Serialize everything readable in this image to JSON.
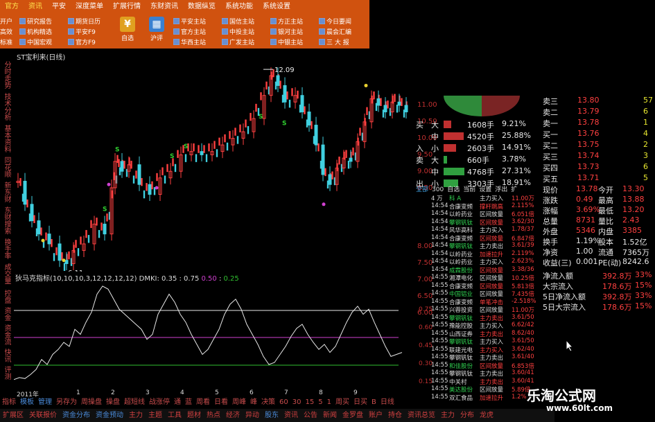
{
  "menu": {
    "tabs": [
      "官方",
      "资讯",
      "平安",
      "深度菜单",
      "扩展行情",
      "东财资讯",
      "数据纵览",
      "系统功能",
      "系统设置"
    ],
    "shortcuts": [
      [
        "开户",
        "研究报告",
        "期货日历"
      ],
      [
        "高效",
        "机构精选",
        "平安F9"
      ],
      [
        "标准",
        "中国宏观",
        "官方F9"
      ]
    ],
    "big": [
      "自选",
      "沪评"
    ],
    "sites": [
      [
        "平安主站",
        "国信主站",
        "方正主站",
        "今日要闻"
      ],
      [
        "官方主站",
        "中投主站",
        "银河主站",
        "晨会汇编"
      ],
      [
        "华西主站",
        "广发主站",
        "中银主站",
        "三 大 报"
      ]
    ]
  },
  "chart": {
    "title": "ST宝利来(日线)",
    "high_label": "12.09",
    "low_label": "6.11",
    "indicator_label": "狄马克指标(10,10,10,3,12,12,12,12) DMKI: 0.35 : 0.75",
    "ind_v1": "0.50",
    "ind_v2": "0.25",
    "x_ticks": [
      "2011年",
      "1",
      "2",
      "3",
      "4",
      "5",
      "6",
      "7",
      "8",
      "9"
    ],
    "k_scale": [
      "11.00",
      "10.50",
      "10.00",
      "9.50",
      "9.00",
      "8.50",
      "8.00",
      "7.50",
      "7.00",
      "6.50",
      "6.00"
    ],
    "i_scale": [
      "0.75",
      "0.60",
      "0.45",
      "0.30",
      "0.15"
    ],
    "colors": {
      "up": "#ff4040",
      "down": "#40d0e0",
      "ma": "#e8e8e8"
    }
  },
  "vtabs": [
    "分时走势",
    "技术分析",
    "基本资料",
    "同花顺",
    "新东财",
    "东财搜索",
    "换手率",
    "成交量"
  ],
  "vtabs2": [
    "控盘",
    "资金",
    "资金流",
    "快讯",
    "评测"
  ],
  "ask": [
    {
      "l": "卖三",
      "p": "13.80",
      "v": "57"
    },
    {
      "l": "卖二",
      "p": "13.79",
      "v": "6"
    },
    {
      "l": "卖一",
      "p": "13.78",
      "v": "1"
    },
    {
      "l": "买一",
      "p": "13.76",
      "v": "4"
    },
    {
      "l": "买二",
      "p": "13.75",
      "v": "2"
    },
    {
      "l": "买三",
      "p": "13.74",
      "v": "3"
    },
    {
      "l": "买四",
      "p": "13.73",
      "v": "6"
    },
    {
      "l": "买五",
      "p": "13.71",
      "v": "5"
    }
  ],
  "flow": [
    {
      "a": "买",
      "b": "大",
      "v": "1608手",
      "p": "9.21%"
    },
    {
      "a": "",
      "b": "中",
      "v": "4520手",
      "p": "25.88%"
    },
    {
      "a": "入",
      "b": "小",
      "v": "2603手",
      "p": "14.91%"
    },
    {
      "a": "卖",
      "b": "大",
      "v": "660手",
      "p": "3.78%"
    },
    {
      "a": "",
      "b": "中",
      "v": "4768手",
      "p": "27.31%"
    },
    {
      "a": "出",
      "b": "小",
      "v": "3303手",
      "p": "18.91%"
    }
  ],
  "flow_fracs": [
    0.35,
    0.9,
    0.55,
    0.15,
    0.95,
    0.65
  ],
  "qtabs": [
    "全部",
    "300",
    "自选",
    "当前",
    "设置",
    "浮出",
    "扩"
  ],
  "stats": [
    {
      "k": "现价",
      "v": "13.78",
      "k2": "今开",
      "v2": "13.30"
    },
    {
      "k": "涨跌",
      "v": "0.49",
      "k2": "最高",
      "v2": "13.88"
    },
    {
      "k": "涨幅",
      "v": "3.69%",
      "k2": "最低",
      "v2": "13.20"
    },
    {
      "k": "总量",
      "v": "8731",
      "k2": "量比",
      "v2": "2.43"
    },
    {
      "k": "外盘",
      "v": "5346",
      "k2": "内盘",
      "v2": "3385"
    },
    {
      "k": "换手",
      "v": "1.19%",
      "k2": "股本",
      "v2": "1.52亿"
    },
    {
      "k": "净资",
      "v": "1.00",
      "k2": "流通",
      "v2": "7365万"
    },
    {
      "k": "收益(三)",
      "v": "0.001",
      "k2": "PE(动)",
      "v2": "8242.6"
    }
  ],
  "netflow": [
    {
      "k": "净流入额",
      "v": "392.8万",
      "p": "33%"
    },
    {
      "k": "大宗流入",
      "v": "178.6万",
      "p": "15%"
    },
    {
      "k": "5日净流入额",
      "v": "392.8万",
      "p": "33%"
    },
    {
      "k": "5日大宗流入",
      "v": "178.6万",
      "p": "15%"
    }
  ],
  "trades": [
    [
      "4 万",
      "科 A",
      "主力买入",
      "11.00万"
    ],
    [
      "14:54",
      "合康变频",
      "撑杆跳高",
      "2.115%"
    ],
    [
      "14:54",
      "以岭药业",
      "区间放量",
      "6.051倍"
    ],
    [
      "14:54",
      "攀钢钒钛",
      "区间放量",
      "3.62/30"
    ],
    [
      "14:54",
      "风华高科",
      "主力买入",
      "1.78/37"
    ],
    [
      "14:54",
      "合康变频",
      "区间放量",
      "6.847倍"
    ],
    [
      "14:54",
      "攀钢钒钛",
      "主力卖出",
      "3.61/39"
    ],
    [
      "14:54",
      "以岭药业",
      "加速拉升",
      "2.119%"
    ],
    [
      "14:54",
      "以岭药业",
      "主力买入",
      "2.623%"
    ],
    [
      "14:54",
      "成霖股份",
      "区间放量",
      "3.38/36"
    ],
    [
      "14:55",
      "湘潭电化",
      "区间放量",
      "10.25倍"
    ],
    [
      "14:55",
      "合康变频",
      "区间放量",
      "5.813倍"
    ],
    [
      "14:55",
      "中国铝业",
      "区间放量",
      "7.435倍"
    ],
    [
      "14:55",
      "合康变频",
      "单笔冲击",
      "-2.518%"
    ],
    [
      "14:55",
      "兴蓉投资",
      "区间放量",
      "11.00万"
    ],
    [
      "14:55",
      "攀钢钒钛",
      "主力卖出",
      "3.61/50"
    ],
    [
      "14:55",
      "豫能控股",
      "主力买入",
      "6.62/42"
    ],
    [
      "14:55",
      "山西证券",
      "主力卖出",
      "8.62/40"
    ],
    [
      "14:55",
      "攀钢钒钛",
      "主力买入",
      "3.61/50"
    ],
    [
      "14:55",
      "联建光电",
      "主力买入",
      "3.62/40"
    ],
    [
      "14:55",
      "攀钢钒钛",
      "主力卖出",
      "3.61/40"
    ],
    [
      "14:55",
      "和佳股份",
      "区间放量",
      "6.853倍"
    ],
    [
      "14:55",
      "攀钢钒钛",
      "主力卖出",
      "3.60/41"
    ],
    [
      "14:55",
      "中关村",
      "主力卖出",
      "3.60/41"
    ],
    [
      "14:55",
      "美达股份",
      "区间放量",
      "5.89倍"
    ],
    [
      "14:55",
      "双汇食品",
      "加速拉升",
      "1.2%"
    ]
  ],
  "bottom1": [
    "指标",
    "模板",
    "管理",
    "另存为",
    "周操盘",
    "操盘",
    "超短线",
    "战涨停",
    "通",
    "蓝",
    "周看",
    "日看",
    "周峰",
    "峰",
    "决策",
    "60",
    "30",
    "15",
    "5",
    "1",
    "周买",
    "日买",
    "B",
    "日线"
  ],
  "bottom2": [
    "扩展区",
    "关联报价",
    "资金分布",
    "资金预动",
    "主力",
    "主题",
    "工具",
    "题材",
    "热点",
    "经济",
    "异动",
    "股东",
    "资讯",
    "公告",
    "新闻",
    "金罗盘",
    "账户",
    "持仓",
    "资讯总览",
    "主力",
    "分布",
    "龙虎"
  ],
  "watermark": "乐淘公式网",
  "watermark_url": "www.60lt.com"
}
